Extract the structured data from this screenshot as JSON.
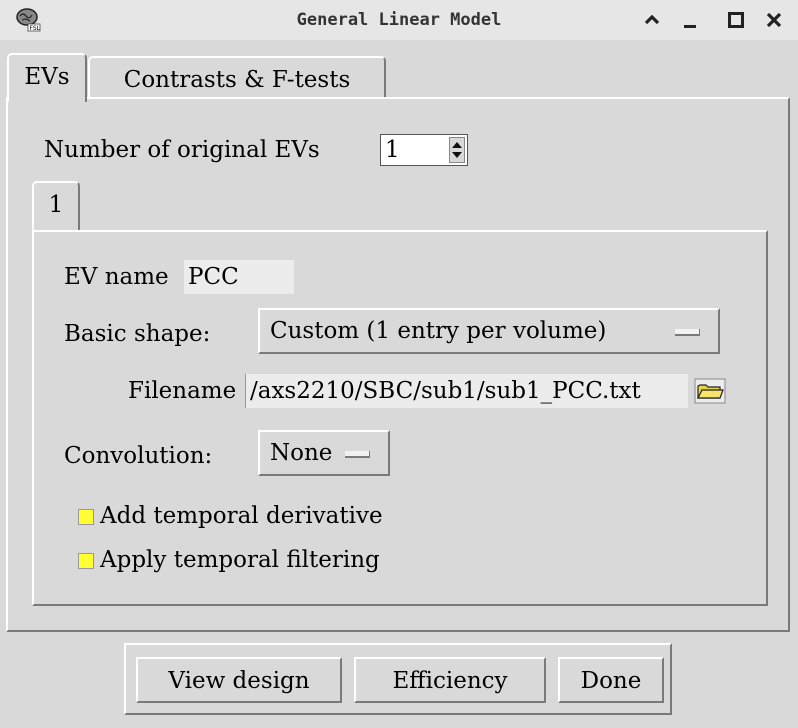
{
  "window": {
    "title": "General Linear Model",
    "icon": "fsl-brain-icon"
  },
  "tabs": [
    {
      "label": "EVs",
      "active": true
    },
    {
      "label": "Contrasts & F-tests",
      "active": false
    }
  ],
  "ev_count": {
    "label": "Number of original EVs",
    "value": "1"
  },
  "ev_tabs": [
    {
      "label": "1",
      "active": true
    }
  ],
  "ev": {
    "name_label": "EV name",
    "name_value": "PCC",
    "shape_label": "Basic shape:",
    "shape_value": "Custom (1 entry per volume)",
    "filename_label": "Filename",
    "filename_value": "/axs2210/SBC/sub1/sub1_PCC.txt",
    "convolution_label": "Convolution:",
    "convolution_value": "None",
    "add_temporal_derivative": "Add temporal derivative",
    "apply_temporal_filtering": "Apply temporal filtering"
  },
  "buttons": {
    "view_design": "View design",
    "efficiency": "Efficiency",
    "done": "Done"
  },
  "colors": {
    "background": "#d9d9d9",
    "checkbox": "#ffff33"
  }
}
